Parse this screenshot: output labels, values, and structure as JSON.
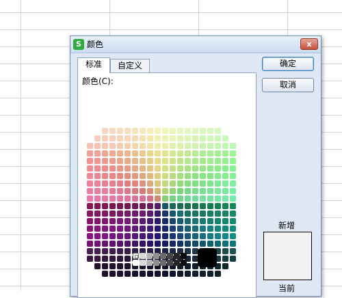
{
  "dialog": {
    "title": "颜色",
    "app_icon": "S",
    "close_glyph": "x"
  },
  "tabs": [
    {
      "label": "标准",
      "active": true
    },
    {
      "label": "自定义",
      "active": false
    }
  ],
  "standard_panel": {
    "colors_label": "颜色(C):"
  },
  "buttons": {
    "ok": "确定",
    "cancel": "取消"
  },
  "preview": {
    "new_label": "新增",
    "current_label": "当前",
    "new_color": "#f2f2f2"
  },
  "grays": [
    "#ffffff",
    "#d9d9d9",
    "#b5b5b5",
    "#8f8f8f",
    "#6b6b6b",
    "#474747",
    "#262626",
    "#0d0d0d"
  ],
  "selected_color": "#000000"
}
